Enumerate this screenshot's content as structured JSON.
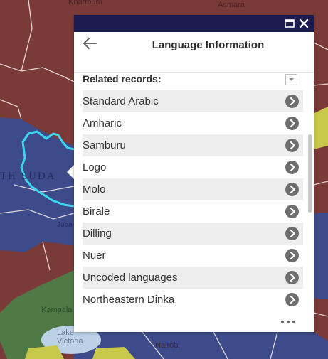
{
  "popup": {
    "title": "Language Information",
    "related_label": "Related records:",
    "items": [
      {
        "label": "Standard Arabic"
      },
      {
        "label": "Amharic"
      },
      {
        "label": "Samburu"
      },
      {
        "label": "Logo"
      },
      {
        "label": "Molo"
      },
      {
        "label": "Birale"
      },
      {
        "label": "Dilling"
      },
      {
        "label": "Nuer"
      },
      {
        "label": "Uncoded languages"
      },
      {
        "label": "Northeastern Dinka"
      }
    ]
  },
  "map": {
    "labels": {
      "khartoum": "Khartoum",
      "asmara": "Asmara",
      "s_sudan": "TH SUDA",
      "juba": "Juba",
      "kampala": "Kampala",
      "lake_victoria": "Lake Victoria",
      "nairobi": "Nairobi"
    }
  },
  "colors": {
    "titlebar": "#1c1c50",
    "map_red": "#7a3a38",
    "map_blue": "#3d4b8a",
    "map_green": "#4f7a46",
    "map_yellow": "#c8c84a",
    "border_cyan": "#3ad8ee"
  }
}
